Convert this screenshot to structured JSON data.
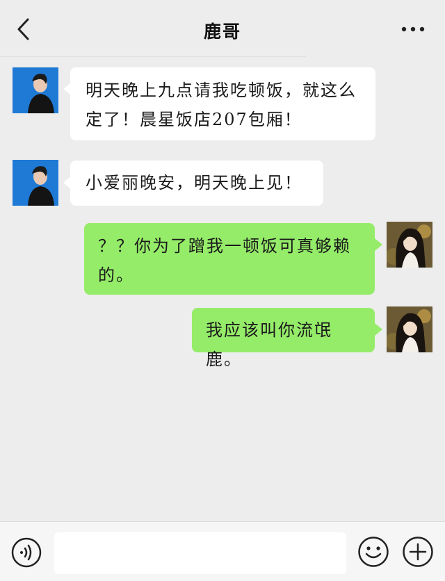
{
  "header": {
    "title": "鹿哥"
  },
  "messages": [
    {
      "side": "incoming",
      "line1": "明天晚上九点请我吃顿饭，就这么",
      "line2": "定了！晨星饭店207包厢！"
    },
    {
      "side": "incoming",
      "line1": "小爱丽晚安，明天晚上见！"
    },
    {
      "side": "outgoing",
      "line1": "？？你为了蹭我一顿饭可真够赖",
      "line2": "的。"
    },
    {
      "side": "outgoing",
      "line1": "我应该叫你流氓鹿。"
    }
  ],
  "input_bar": {
    "placeholder": "",
    "value": ""
  },
  "icons": {
    "back": "chevron-left-icon",
    "more": "more-dots-icon",
    "voice": "voice-icon",
    "emoji": "emoji-icon",
    "plus": "plus-icon"
  },
  "colors": {
    "background": "#ededed",
    "incoming_bubble": "#ffffff",
    "outgoing_bubble": "#95ec69",
    "text": "#1a1a1a"
  }
}
